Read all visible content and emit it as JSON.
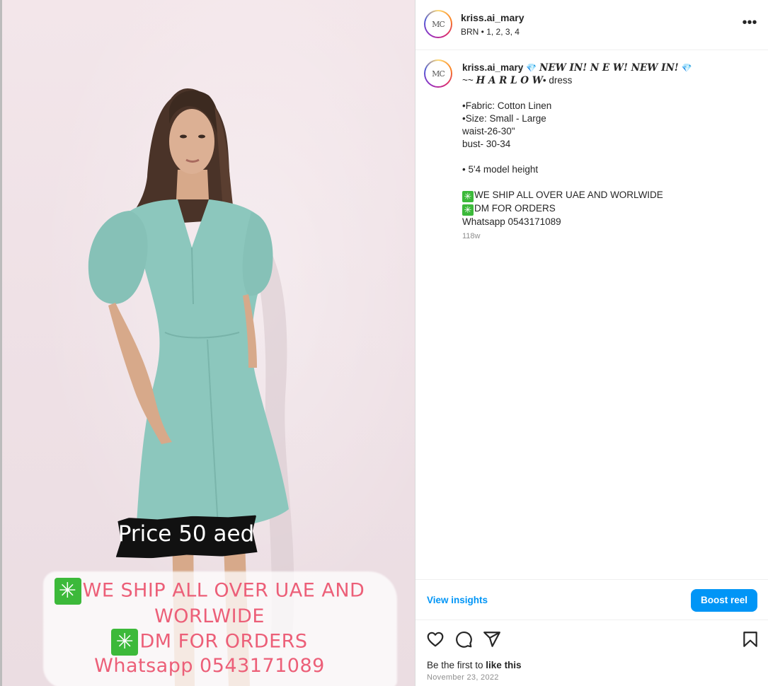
{
  "post": {
    "username": "kriss.ai_mary",
    "avatar_initials": "MC",
    "location": "BRN • 1, 2, 3, 4",
    "more_icon": "more-horizontal-icon"
  },
  "media_overlay": {
    "price": "Price 50 aed",
    "ship_line_1": "WE SHIP ALL OVER UAE  AND",
    "ship_line_2": "WORLWIDE",
    "dm_line": "DM FOR ORDERS",
    "whatsapp_line": "Whatsapp 0543171089",
    "star_glyph": "✳"
  },
  "caption": {
    "username": "kriss.ai_mary",
    "gem": "💎",
    "headline": "𝑵𝑬𝑾 𝑰𝑵! 𝑵 𝑬 𝑾! 𝑵𝑬𝑾 𝑰𝑵!",
    "line2_prefix": "~~ ",
    "line2_name": "𝑯 𝑨 𝑹 𝑳 𝑶 𝑾",
    "line2_suffix": "• dress",
    "fabric": "•Fabric: Cotton Linen",
    "size": "•Size: Small - Large",
    "waist": "waist-26-30\"",
    "bust": "bust- 30-34",
    "model_height": "• 5'4 model height",
    "ship": "WE SHIP ALL OVER UAE AND WORLWIDE",
    "dm": "DM FOR ORDERS",
    "whatsapp": "Whatsapp 0543171089",
    "age": "118w"
  },
  "actions": {
    "view_insights": "View insights",
    "boost_reel": "Boost reel",
    "like_icon": "heart-icon",
    "comment_icon": "comment-icon",
    "share_icon": "share-icon",
    "save_icon": "bookmark-icon"
  },
  "likes": {
    "prefix": "Be the first to ",
    "link": "like this"
  },
  "date": "November 23, 2022",
  "colors": {
    "link_blue": "#0095f6",
    "overlay_pink": "#ec5f78",
    "dress_teal": "#8cc7bd",
    "star_green": "#3cb93a"
  }
}
